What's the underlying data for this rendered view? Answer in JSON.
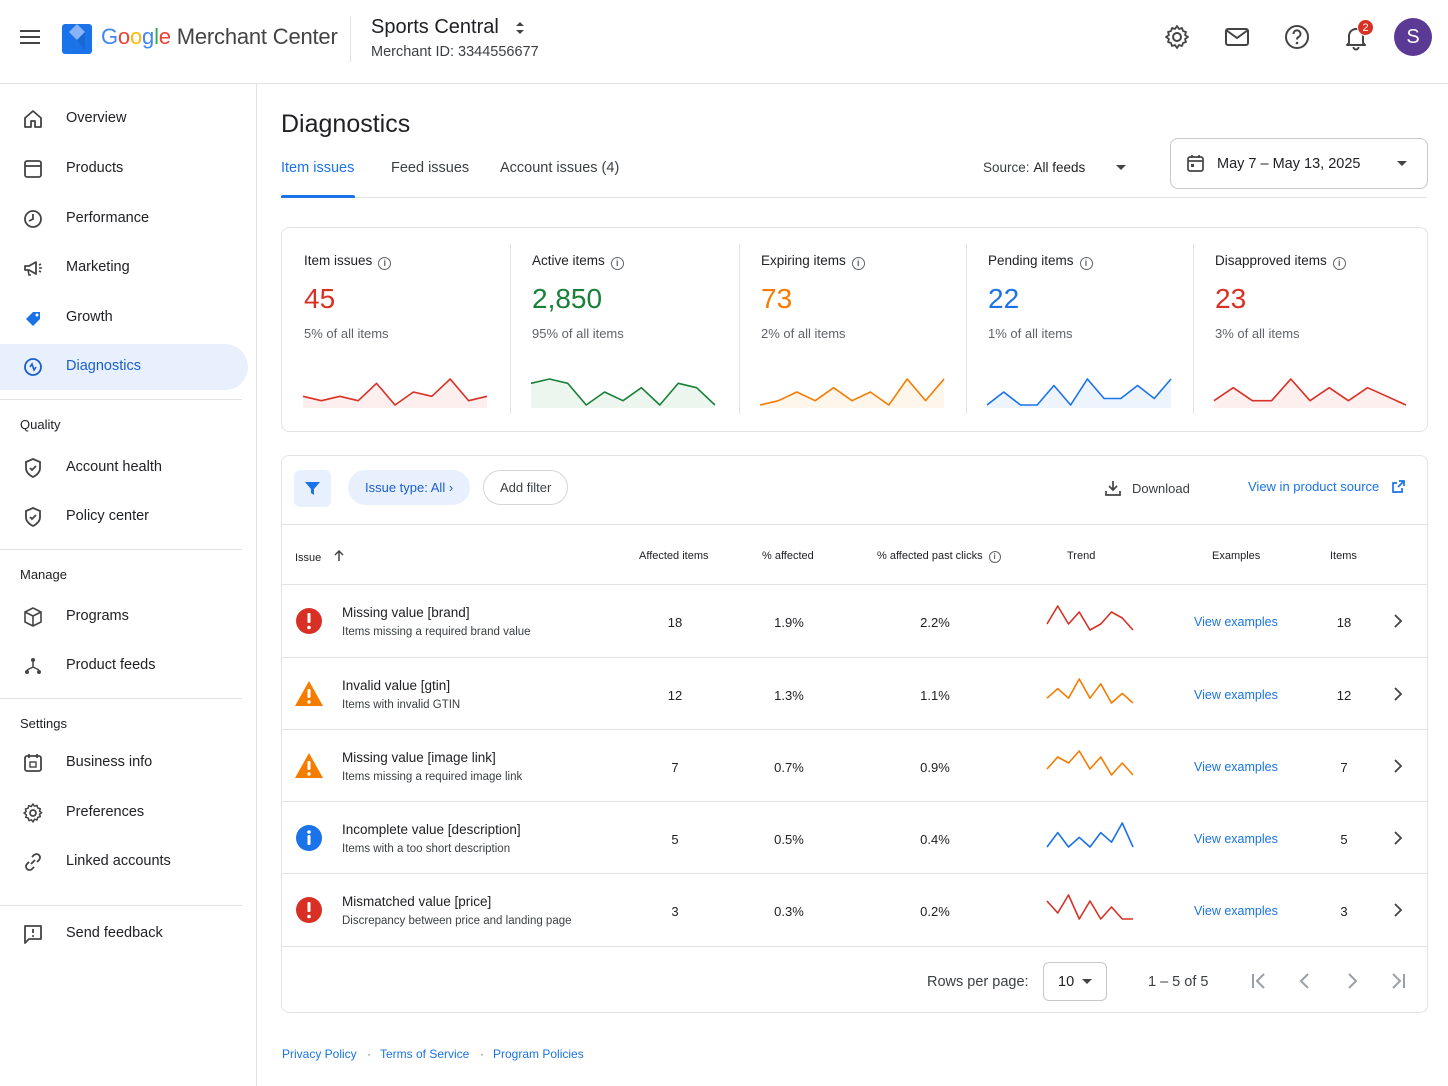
{
  "header": {
    "logo_google": [
      "G",
      "o",
      "o",
      "g",
      "l",
      "e"
    ],
    "logo_product": "Merchant Center",
    "account_name": "Sports Central",
    "merchant_id": "Merchant ID: 3344556677",
    "notification_count": "2",
    "avatar_letter": "S"
  },
  "sidebar": {
    "items": [
      {
        "label": "Overview",
        "icon": "home-icon"
      },
      {
        "label": "Products",
        "icon": "products-icon"
      },
      {
        "label": "Performance",
        "icon": "performance-icon"
      },
      {
        "label": "Marketing",
        "icon": "megaphone-icon"
      },
      {
        "label": "Growth",
        "icon": "growth-icon"
      },
      {
        "label": "Diagnostics",
        "icon": "diagnostics-icon",
        "active": true
      }
    ],
    "quality_heading": "Quality",
    "quality_items": [
      {
        "label": "Account health",
        "icon": "shield-check-icon"
      },
      {
        "label": "Policy center",
        "icon": "shield-check-icon"
      }
    ],
    "manage_heading": "Manage",
    "manage_items": [
      {
        "label": "Programs",
        "icon": "cube-icon"
      },
      {
        "label": "Product feeds",
        "icon": "feeds-icon"
      }
    ],
    "settings_heading": "Settings",
    "settings_items": [
      {
        "label": "Business info",
        "icon": "business-calendar-icon"
      },
      {
        "label": "Preferences",
        "icon": "gear-icon"
      },
      {
        "label": "Linked accounts",
        "icon": "link-icon"
      }
    ],
    "feedback": "Send feedback"
  },
  "main": {
    "title": "Diagnostics",
    "tabs": [
      "Item issues",
      "Feed issues",
      "Account issues (4)"
    ],
    "source_label": "Source:",
    "source_value": "All feeds",
    "date_range": "May 7 – May 13, 2025"
  },
  "summary": [
    {
      "label": "Item issues",
      "value": "45",
      "sub": "5% of all items",
      "color": "#d93025",
      "trend": [
        3,
        2,
        3,
        2,
        6,
        1,
        4,
        3,
        7,
        2,
        3
      ]
    },
    {
      "label": "Active items",
      "value": "2,850",
      "sub": "95% of all items",
      "color": "#188038",
      "trend": [
        6,
        7,
        6,
        1,
        4,
        2,
        5,
        1,
        6,
        5,
        1
      ]
    },
    {
      "label": "Expiring items",
      "value": "73",
      "sub": "2% of all items",
      "color": "#f57c00",
      "trend": [
        2,
        3,
        5,
        3,
        6,
        3,
        5,
        2,
        8,
        3,
        8
      ]
    },
    {
      "label": "Pending items",
      "value": "22",
      "sub": "1% of all items",
      "color": "#1a73e8",
      "trend": [
        3,
        5,
        3,
        3,
        6,
        3,
        7,
        4,
        4,
        6,
        4,
        7
      ]
    },
    {
      "label": "Disapproved items",
      "value": "23",
      "sub": "3% of all items",
      "color": "#d93025",
      "trend": [
        2,
        5,
        2,
        2,
        7,
        2,
        5,
        2,
        5,
        3,
        1
      ]
    }
  ],
  "issues": {
    "filter_chip": "Issue type: All",
    "add_filter": "Add filter",
    "download": "Download",
    "view_source": "View in product source",
    "columns": [
      "Issue",
      "Affected items",
      "% affected",
      "% affected past clicks",
      "Trend",
      "Examples",
      "Items"
    ],
    "rows": [
      {
        "title": "Missing value [brand]",
        "desc": "Items missing a required brand value",
        "severity": "error",
        "affected": "18",
        "pct": "1.9%",
        "clicks": "2.2%",
        "link": "View examples",
        "items": "18",
        "color": "#d93025",
        "trend": [
          2,
          5,
          2,
          4,
          1,
          2,
          4,
          3,
          1
        ]
      },
      {
        "title": "Invalid value [gtin]",
        "desc": "Items with invalid GTIN",
        "severity": "warning",
        "affected": "12",
        "pct": "1.3%",
        "clicks": "1.1%",
        "link": "View examples",
        "items": "12",
        "color": "#f57c00",
        "trend": [
          2,
          4,
          2,
          6,
          2,
          5,
          1,
          3,
          1
        ]
      },
      {
        "title": "Missing value [image link]",
        "desc": "Items missing a required image link",
        "severity": "warning",
        "affected": "7",
        "pct": "0.7%",
        "clicks": "0.9%",
        "link": "View examples",
        "items": "7",
        "color": "#f57c00",
        "trend": [
          2,
          4,
          3,
          5,
          2,
          4,
          1,
          3,
          1
        ]
      },
      {
        "title": "Incomplete value [description]",
        "desc": "Items with a too short description",
        "severity": "info",
        "affected": "5",
        "pct": "0.5%",
        "clicks": "0.4%",
        "link": "View examples",
        "items": "5",
        "color": "#1a73e8",
        "trend": [
          1,
          4,
          1,
          3,
          1,
          4,
          2,
          6,
          1
        ]
      },
      {
        "title": "Mismatched value [price]",
        "desc": "Discrepancy between price and landing page",
        "severity": "error",
        "affected": "3",
        "pct": "0.3%",
        "clicks": "0.2%",
        "link": "View examples",
        "items": "3",
        "color": "#d93025",
        "trend": [
          4,
          2,
          5,
          1,
          4,
          1,
          3,
          1,
          1
        ]
      }
    ],
    "rows_per_page_label": "Rows per page:",
    "rows_per_page": "10",
    "range": "1 – 5 of 5"
  },
  "footer": [
    "Privacy Policy",
    "Terms of Service",
    "Program Policies"
  ]
}
